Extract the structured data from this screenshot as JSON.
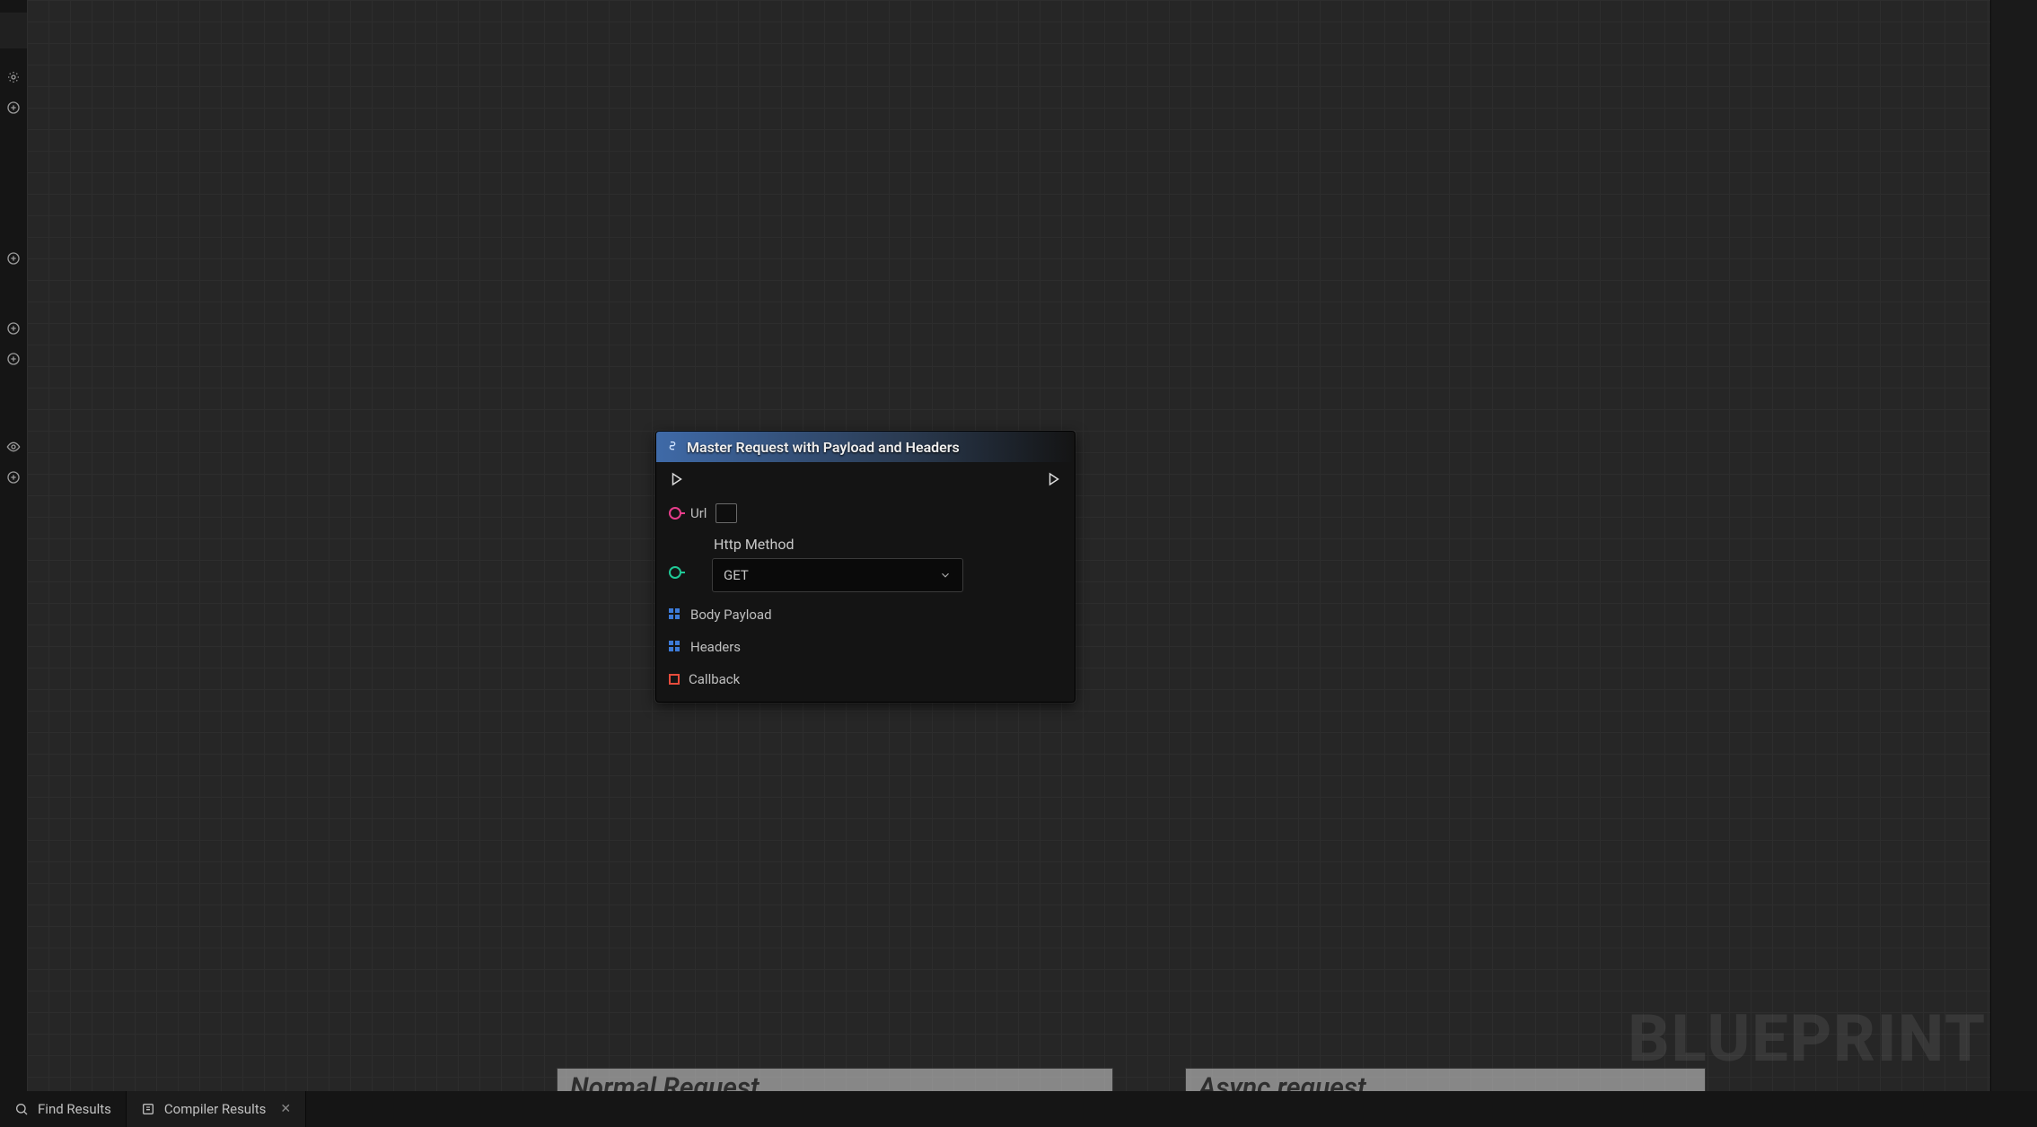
{
  "watermark": "BLUEPRINT",
  "sidebar_icons": [
    "gear-icon",
    "plus-icon",
    "plus-icon",
    "plus-icon",
    "plus-icon",
    "eye-icon",
    "plus-icon"
  ],
  "node": {
    "title": "Master Request with Payload and Headers",
    "pins": {
      "url_label": "Url",
      "http_method_label": "Http Method",
      "http_method_value": "GET",
      "body_payload_label": "Body Payload",
      "headers_label": "Headers",
      "callback_label": "Callback"
    }
  },
  "comments": {
    "normal": "Normal Request",
    "async": "Async request"
  },
  "bottom_bar": {
    "find_results": "Find Results",
    "compiler_results": "Compiler Results"
  }
}
